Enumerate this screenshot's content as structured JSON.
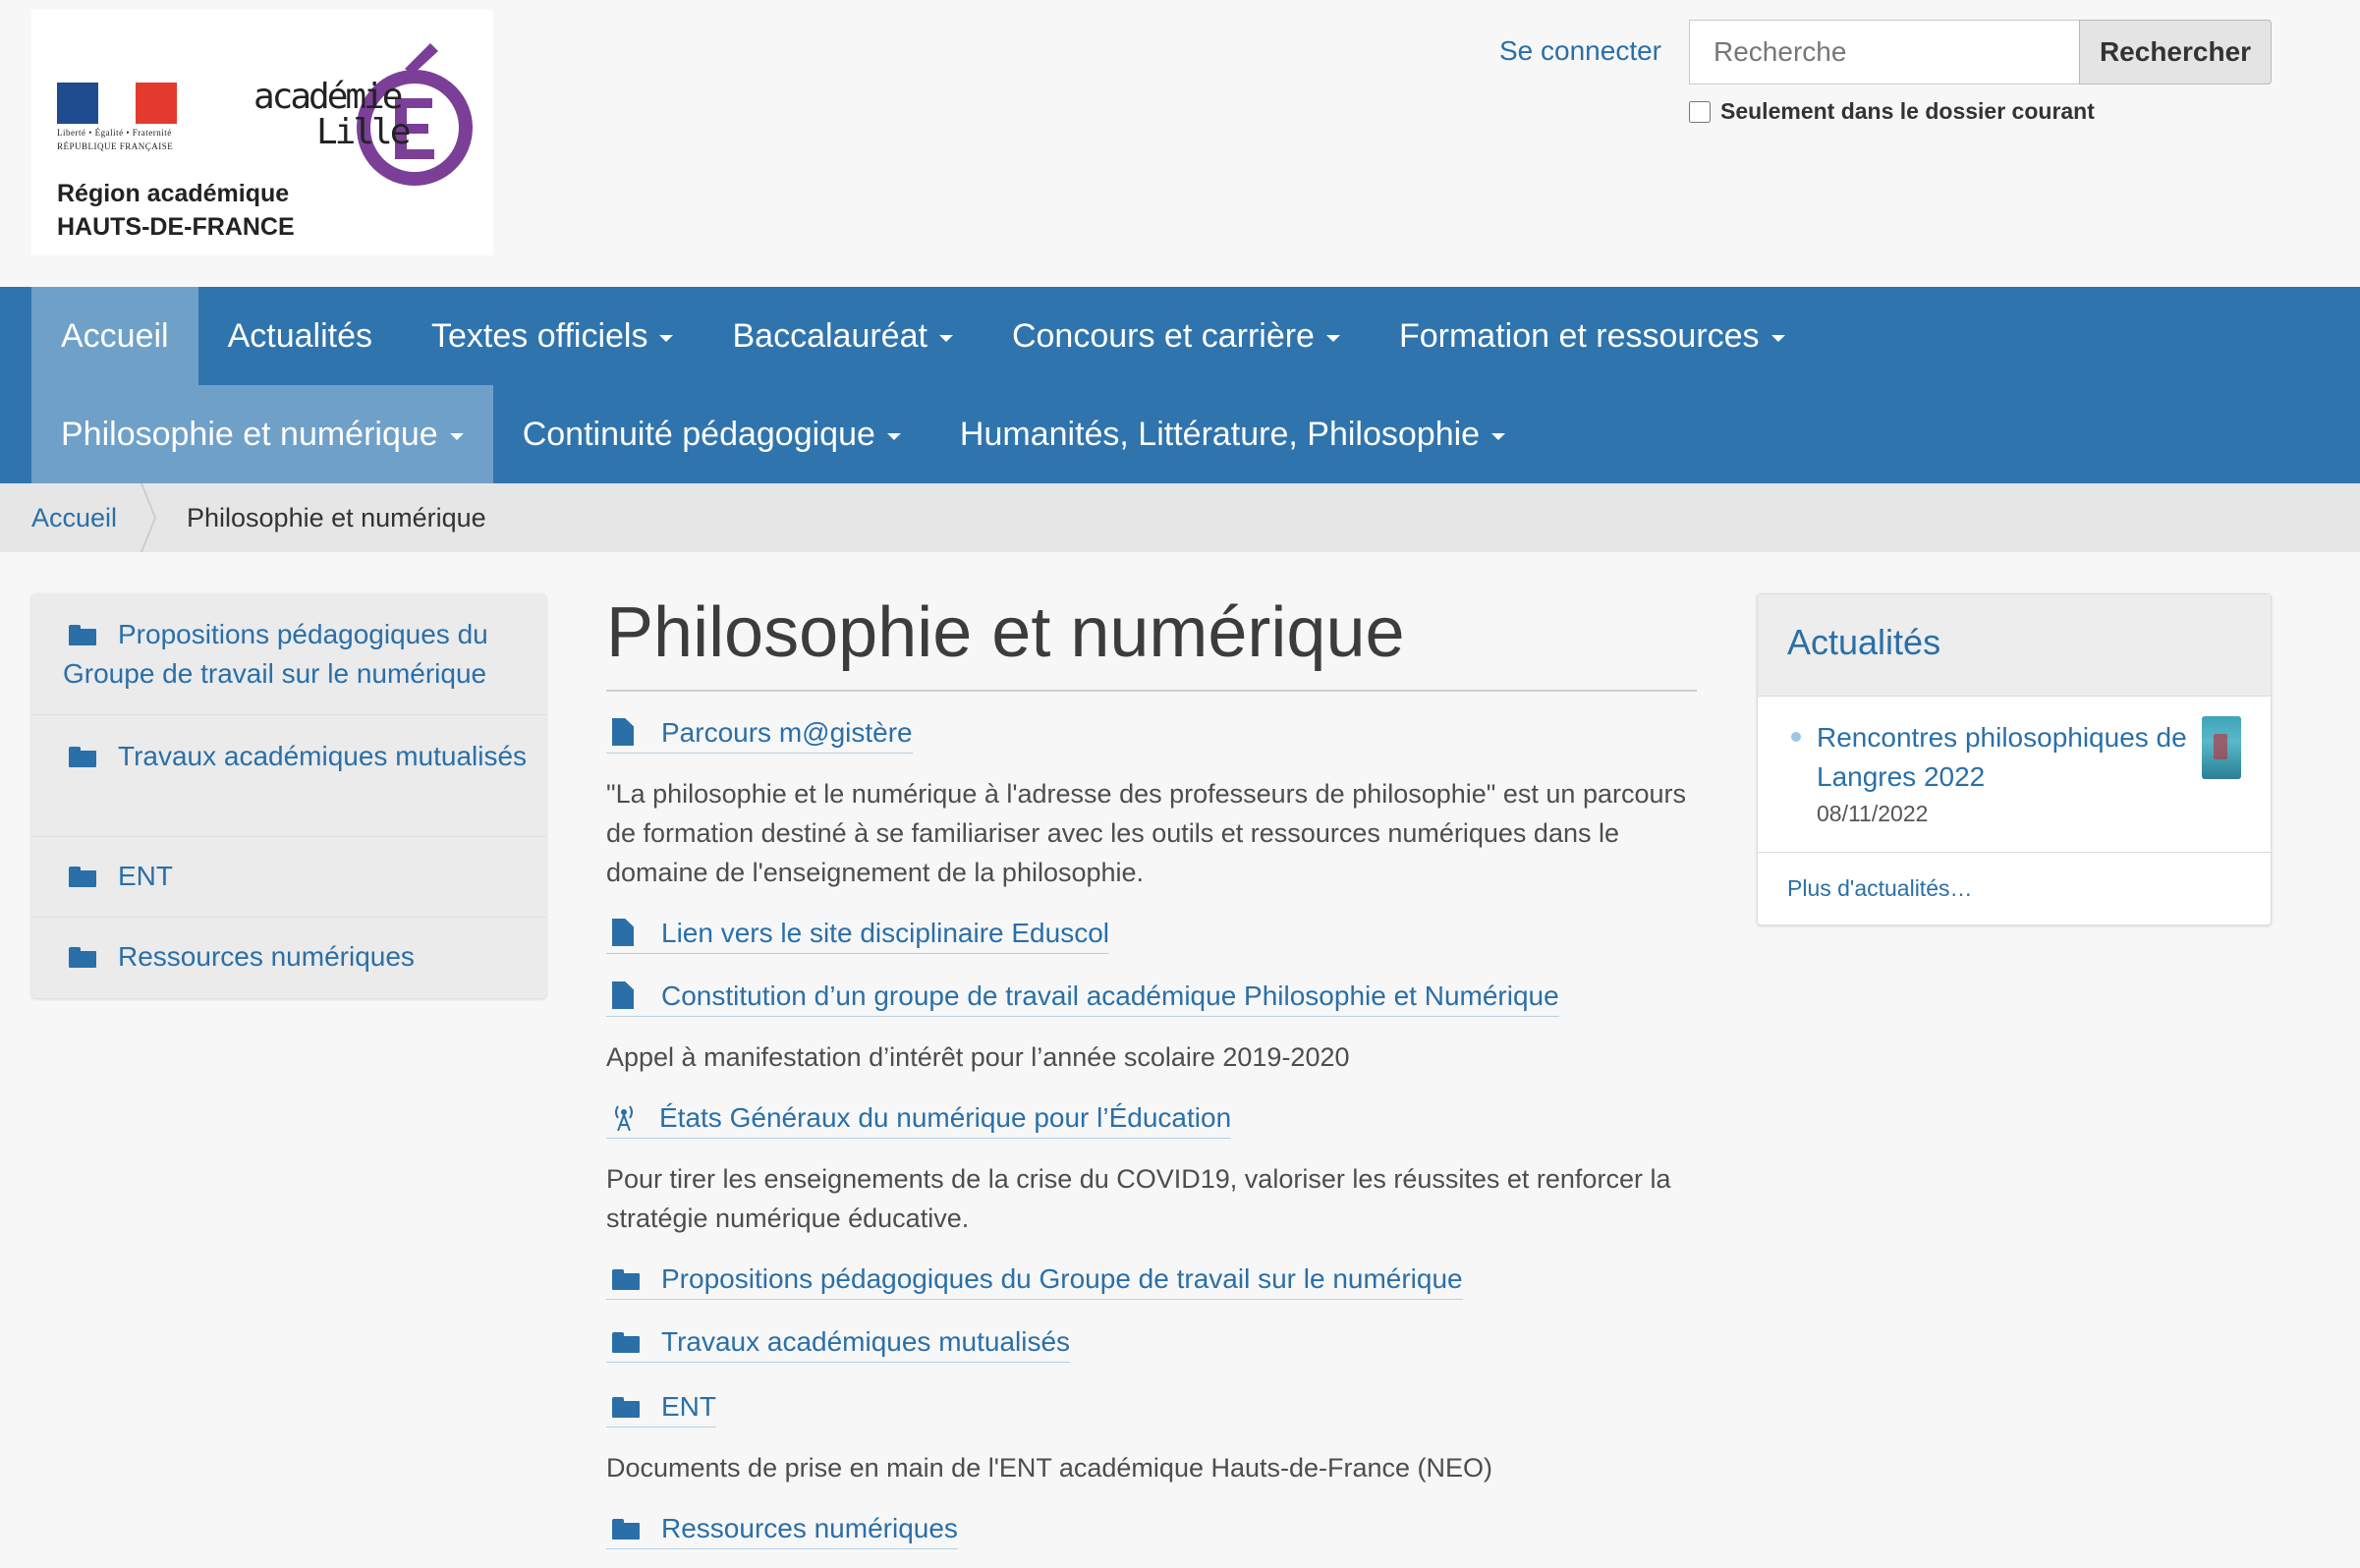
{
  "header": {
    "logo": {
      "motto": "Liberté • Égalité • Fraternité",
      "republique": "RÉPUBLIQUE FRANÇAISE",
      "academie": "académie",
      "lille": "Lille",
      "region_line1": "Région académique",
      "region_line2": "HAUTS-DE-FRANCE"
    },
    "login_label": "Se connecter",
    "search": {
      "placeholder": "Recherche",
      "button_label": "Rechercher",
      "checkbox_label": "Seulement dans le dossier courant"
    }
  },
  "nav": {
    "row1": [
      {
        "label": "Accueil"
      },
      {
        "label": "Actualités"
      },
      {
        "label": "Textes officiels"
      },
      {
        "label": "Baccalauréat"
      },
      {
        "label": "Concours et carrière"
      },
      {
        "label": "Formation et ressources"
      }
    ],
    "row2": [
      {
        "label": "Philosophie et numérique"
      },
      {
        "label": "Continuité pédagogique"
      },
      {
        "label": "Humanités, Littérature, Philosophie"
      }
    ]
  },
  "breadcrumb": {
    "home": "Accueil",
    "current": "Philosophie et numérique"
  },
  "sidebar": {
    "items": [
      {
        "label": "Propositions pédagogiques du Groupe de travail sur le numérique"
      },
      {
        "label": "Travaux académiques mutualisés"
      },
      {
        "label": "ENT"
      },
      {
        "label": "Ressources numériques"
      }
    ]
  },
  "main": {
    "title": "Philosophie et numérique",
    "entries": [
      {
        "icon": "document-icon",
        "label": "Parcours m@gistère",
        "description": "\"La philosophie et le numérique à l'adresse des professeurs de philosophie\" est un parcours de formation destiné à se familiariser avec les outils et ressources numériques dans le domaine de l'enseignement de la philosophie."
      },
      {
        "icon": "document-icon",
        "label": "Lien vers le site disciplinaire Eduscol",
        "description": ""
      },
      {
        "icon": "document-icon",
        "label": "Constitution d’un groupe de travail académique Philosophie et Numérique",
        "description": "Appel à manifestation d’intérêt pour l’année scolaire 2019-2020"
      },
      {
        "icon": "antenna-icon",
        "label": "États Généraux du numérique pour l’Éducation",
        "description": "Pour tirer les enseignements de la crise du COVID19, valoriser les réussites et renforcer la stratégie numérique éducative."
      },
      {
        "icon": "folder-icon",
        "label": "Propositions pédagogiques du Groupe de travail sur le numérique",
        "description": ""
      },
      {
        "icon": "folder-icon",
        "label": "Travaux académiques mutualisés",
        "description": ""
      },
      {
        "icon": "folder-icon",
        "label": "ENT",
        "description": "Documents de prise en main de l'ENT académique Hauts-de-France (NEO)"
      },
      {
        "icon": "folder-icon",
        "label": "Ressources numériques",
        "description": ""
      }
    ]
  },
  "portlet": {
    "title": "Actualités",
    "news": [
      {
        "title": "Rencontres philosophiques de Langres 2022",
        "date": "08/11/2022"
      }
    ],
    "more_label": "Plus d'actualités…"
  },
  "colors": {
    "nav_background": "#2f74ad",
    "nav_active": "#6fa0c8",
    "link": "#2a6fa8",
    "logo_e": "#7b3f98"
  }
}
